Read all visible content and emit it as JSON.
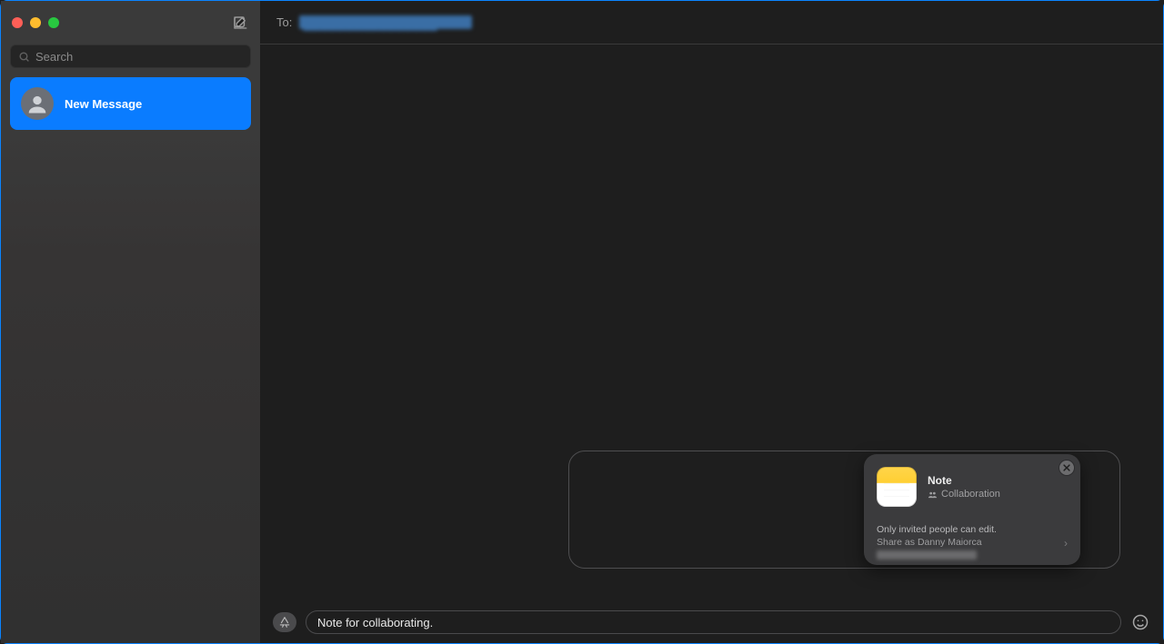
{
  "window": {
    "compose_tooltip": "Compose"
  },
  "sidebar": {
    "search_placeholder": "Search",
    "conversations": [
      {
        "title": "New Message"
      }
    ]
  },
  "header": {
    "to_label": "To:",
    "to_value_redacted": "████████████████"
  },
  "share_card": {
    "title": "Note",
    "subtitle": "Collaboration",
    "permission": "Only invited people can edit.",
    "share_as": "Share as Danny Maiorca"
  },
  "compose": {
    "message_text": "Note for collaborating.",
    "apps_label": "Apps",
    "emoji_label": "Emoji"
  }
}
